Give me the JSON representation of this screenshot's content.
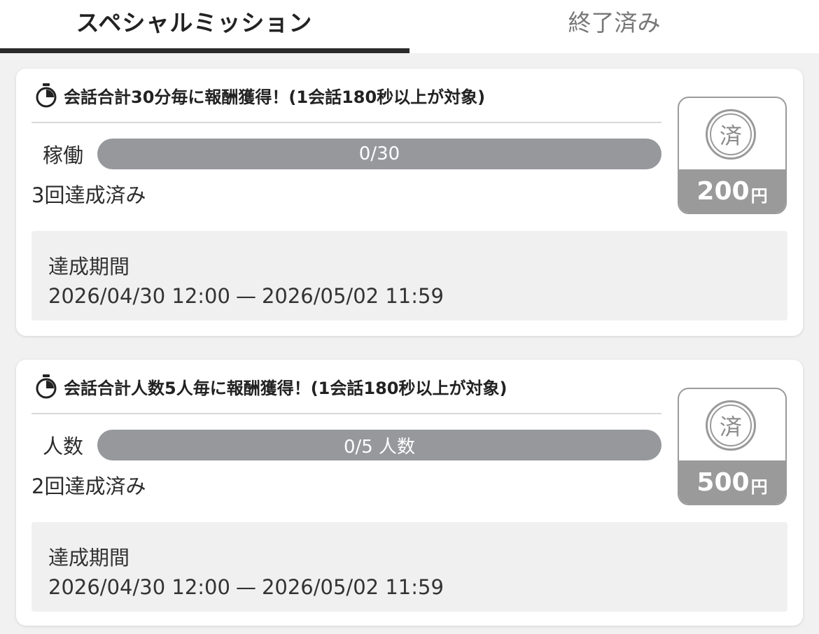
{
  "tabs": {
    "special_missions": "スペシャルミッション",
    "completed": "終了済み"
  },
  "missions": [
    {
      "title": "会話合計30分毎に報酬獲得！(1会話180秒以上が対象)",
      "progress_label": "稼働",
      "progress_text": "0/30",
      "progress_value": 0,
      "progress_max": 30,
      "achieved_text": "3回達成済み",
      "period_label": "達成期間",
      "period_start": "2026/04/30 12:00",
      "period_separator": "—",
      "period_end": "2026/05/02 11:59",
      "stamp_text": "済",
      "reward_amount": "200",
      "reward_unit": "円"
    },
    {
      "title": "会話合計人数5人毎に報酬獲得！(1会話180秒以上が対象)",
      "progress_label": "人数",
      "progress_text": "0/5 人数",
      "progress_value": 0,
      "progress_max": 5,
      "achieved_text": "2回達成済み",
      "period_label": "達成期間",
      "period_start": "2026/04/30 12:00",
      "period_separator": "—",
      "period_end": "2026/05/02 11:59",
      "stamp_text": "済",
      "reward_amount": "500",
      "reward_unit": "円"
    }
  ],
  "icons": {
    "timer": "stopwatch-icon",
    "done_stamp": "completed-stamp-icon"
  },
  "colors": {
    "progress_bar": "#96989c",
    "reward_badge": "#9a9a9a",
    "active_tab_underline": "#2a2a2a"
  }
}
